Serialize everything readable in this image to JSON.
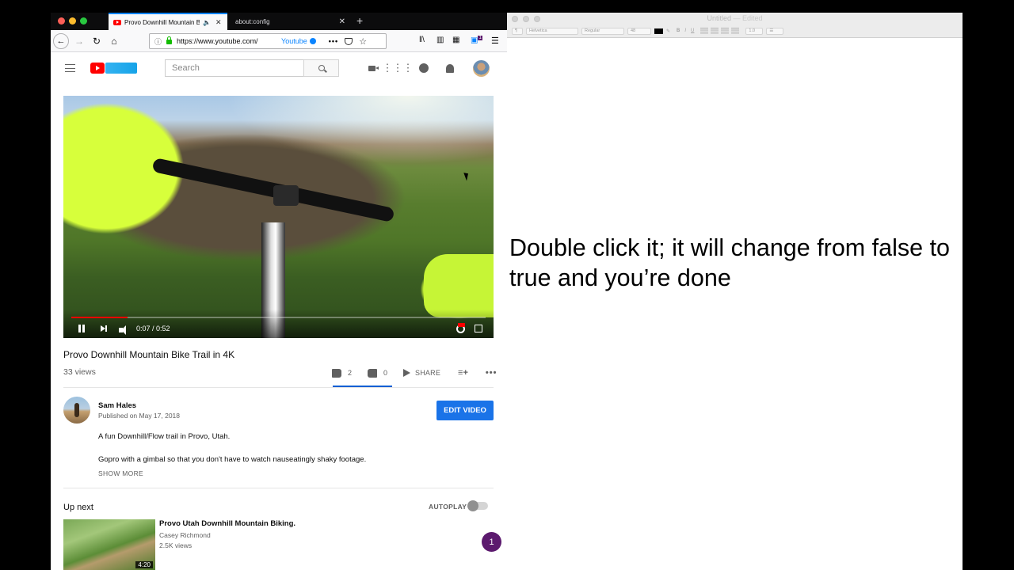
{
  "browser": {
    "tabs": [
      {
        "title": "Provo Downhill Mountain Bike",
        "active": true
      },
      {
        "title": "about:config",
        "active": false
      }
    ],
    "new_tab_label": "+",
    "url": "https://www.youtube.com/",
    "bookmark_label": "Youtube",
    "more_label": "•••",
    "star_label": "☆",
    "extension_badge": "1"
  },
  "youtube": {
    "search_placeholder": "Search",
    "video": {
      "time": "0:07 / 0:52",
      "progress_fraction": 0.135
    },
    "title": "Provo Downhill Mountain Bike Trail in 4K",
    "views": "33 views",
    "likes": "2",
    "dislikes": "0",
    "share_label": "SHARE",
    "owner": {
      "name": "Sam Hales",
      "published": "Published on May 17, 2018"
    },
    "edit_button": "EDIT VIDEO",
    "description": [
      "A fun Downhill/Flow trail in Provo, Utah.",
      "Gopro with a gimbal so that you don't have to watch nauseatingly shaky footage."
    ],
    "show_more": "SHOW MORE",
    "up_next_label": "Up next",
    "autoplay_label": "AUTOPLAY",
    "autoplay_on": false,
    "next_video": {
      "title": "Provo Utah Downhill Mountain Biking.",
      "channel": "Casey Richmond",
      "views": "2.5K views",
      "duration": "4:20"
    },
    "notification_count": "1"
  },
  "textedit": {
    "title": "Untitled",
    "edited_label": "— Edited",
    "toolbar": {
      "font_family": "Helvetica",
      "font_style": "Regular",
      "font_size": "48",
      "bold": "B",
      "italic": "I",
      "underline": "U",
      "line_spacing": "1.0"
    },
    "body_text": "Double click it; it will change from false to true and you’re done"
  }
}
